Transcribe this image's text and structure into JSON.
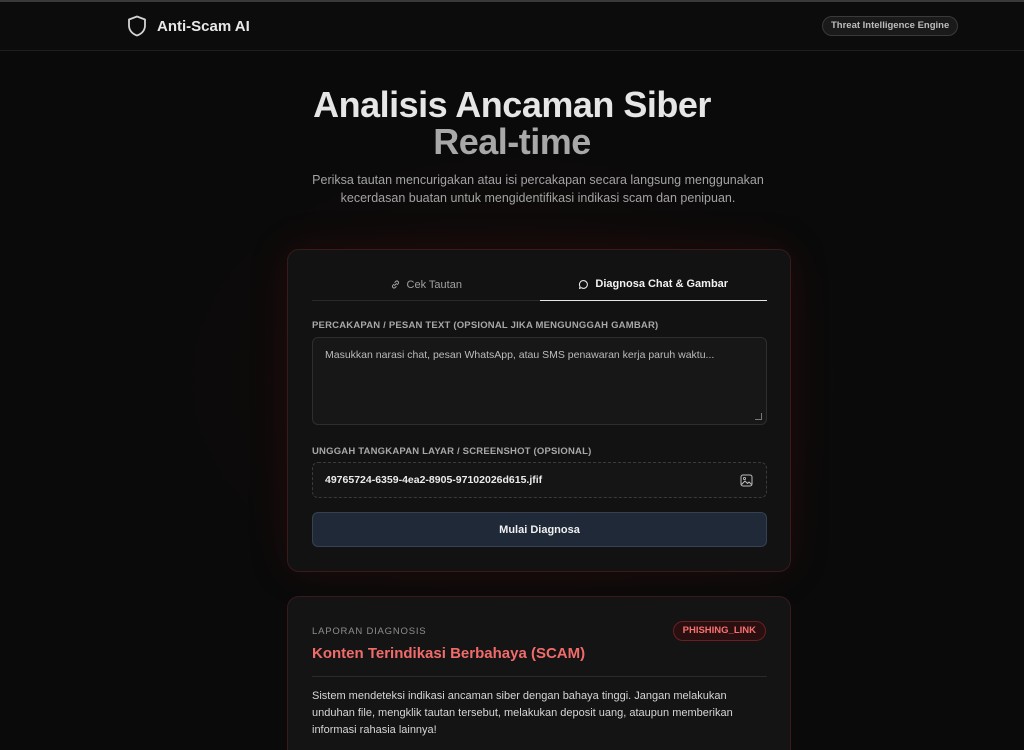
{
  "app": {
    "brand": "Anti-Scam AI",
    "badge": "Threat Intelligence Engine"
  },
  "hero": {
    "title_line1": "Analisis Ancaman Siber",
    "title_line2": "Real-time",
    "subtitle": "Periksa tautan mencurigakan atau isi percakapan secara langsung menggunakan kecerdasan buatan untuk mengidentifikasi indikasi scam dan penipuan."
  },
  "form": {
    "tabs": [
      {
        "label": "Cek Tautan",
        "icon": "link-icon",
        "active": false
      },
      {
        "label": "Diagnosa Chat & Gambar",
        "icon": "chat-bubble-icon",
        "active": true
      }
    ],
    "message_label": "PERCAKAPAN / PESAN TEXT (OPSIONAL JIKA MENGUNGGAH GAMBAR)",
    "message_placeholder": "Masukkan narasi chat, pesan WhatsApp, atau SMS penawaran kerja paruh waktu...",
    "upload_label": "UNGGAH TANGKAPAN LAYAR / SCREENSHOT (OPSIONAL)",
    "upload_filename": "49765724-6359-4ea2-8905-97102026d615.jfif",
    "upload_icon": "image-icon",
    "submit_label": "Mulai Diagnosa"
  },
  "report": {
    "kicker": "LAPORAN DIAGNOSIS",
    "badge": "PHISHING_LINK",
    "title": "Konten Terindikasi Berbahaya (SCAM)",
    "body": "Sistem mendeteksi indikasi ancaman siber dengan bahaya tinggi. Jangan melakukan unduhan file, mengklik tautan tersebut, melakukan deposit uang, ataupun memberikan informasi rahasia lainnya!"
  },
  "colors": {
    "background": "#0a0a0a",
    "danger": "#f26b6b",
    "button": "#1f2937"
  }
}
